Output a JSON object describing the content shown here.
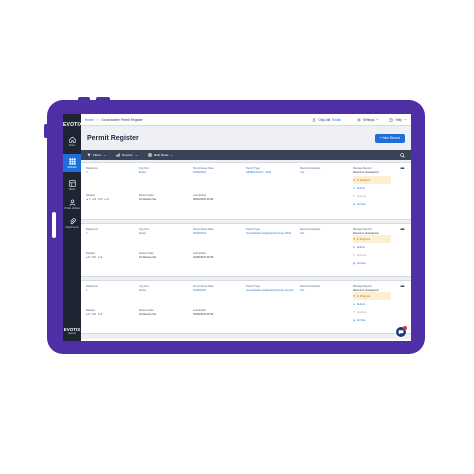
{
  "app": {
    "logo": "EVOTIX",
    "logo_bottom": "EVOTIX",
    "logo_bottom_sub": "Assure"
  },
  "rail": [
    {
      "label": "Home",
      "icon": "home-icon"
    },
    {
      "label": "Modules",
      "icon": "grid-icon"
    },
    {
      "label": "Tables",
      "icon": "table-icon"
    },
    {
      "label": "Profile Upload",
      "icon": "user-icon"
    },
    {
      "label": "Attachments",
      "icon": "paperclip-icon"
    }
  ],
  "topbar": {
    "breadcrumb_home": "Home",
    "breadcrumb_sep": ">",
    "breadcrumb_current": "Groundwater Permit Register",
    "user_label": "Org Unit",
    "user_org": "Evotix",
    "settings_label": "Settings",
    "help_label": "Help"
  },
  "page": {
    "title": "Permit Register",
    "new_button": "+ New Record"
  },
  "toolbar": {
    "filters": "Filters",
    "reports": "Reports",
    "multi_mode": "Multi Mode"
  },
  "labels": {
    "reference": "Reference",
    "org_unit": "Org Unit",
    "issue_date": "Permit Issue Date",
    "permit_type": "Permit Type",
    "record_complete": "Record Complete",
    "manage_record": "Manage Record",
    "record_is": "Record is",
    "related": "Related",
    "review_date": "Review Date",
    "last_edited": "Last Edited",
    "in_progress": "In Progress",
    "submit": "Submit",
    "approve": "Approve",
    "archive": "Archive"
  },
  "records": [
    {
      "reference": "3",
      "org_unit": "Evotix",
      "issue_date": "04/15/2022",
      "permit_type": "NPDES Permit - 2024",
      "record_complete": "Yes",
      "status": "Unassigned",
      "related": [
        {
          "icon": "alert-icon",
          "count": "3"
        },
        {
          "icon": "paperclip-icon",
          "count": "0"
        },
        {
          "icon": "copy-icon",
          "count": "0"
        },
        {
          "icon": "comment-icon",
          "count": "0"
        }
      ],
      "review_date": "No Review Set",
      "last_edited": "08/22/2023 10:39"
    },
    {
      "reference": "2",
      "org_unit": "Evotix",
      "issue_date": "03/29/2023",
      "permit_type": "Groundwater Analytical Summary 2022",
      "record_complete": "Yes",
      "status": "Unassigned",
      "related": [
        {
          "icon": "paperclip-icon",
          "count": "0"
        },
        {
          "icon": "copy-icon",
          "count": "0"
        },
        {
          "icon": "comment-icon",
          "count": "0"
        }
      ],
      "review_date": "No Review Set",
      "last_edited": "01/25/2023 09:45"
    },
    {
      "reference": "1",
      "org_unit": "Evotix",
      "issue_date": "01/25/2023",
      "permit_type": "Groundwater Analytical Summary Annual",
      "record_complete": "Yes",
      "status": "Unassigned",
      "related": [
        {
          "icon": "paperclip-icon",
          "count": "0"
        },
        {
          "icon": "copy-icon",
          "count": "0"
        },
        {
          "icon": "comment-icon",
          "count": "0"
        }
      ],
      "review_date": "No Review Set",
      "last_edited": "01/25/2023 09:45"
    }
  ],
  "colors": {
    "frame": "#4e2fa6",
    "accent": "#1e6fd9",
    "rail": "#1f2433",
    "toolbar": "#3a4255",
    "in_progress_bg": "#fdf0d2"
  }
}
